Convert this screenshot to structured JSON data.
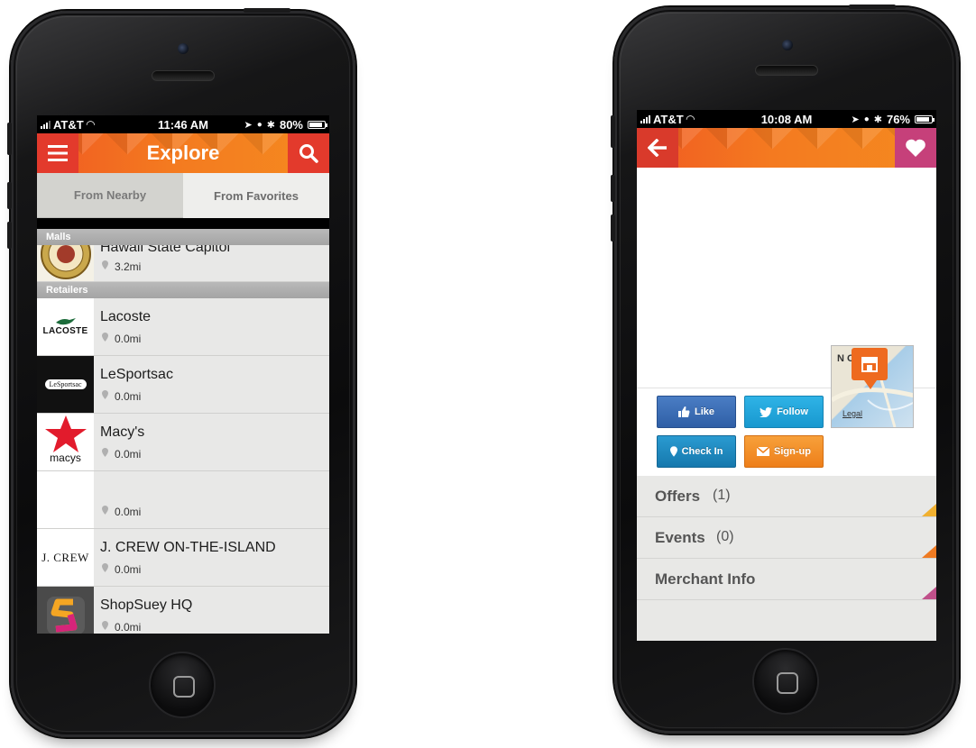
{
  "left_phone": {
    "status": {
      "carrier": "AT&T",
      "time": "11:46 AM",
      "battery": "80%"
    },
    "header": {
      "title": "Explore",
      "menu_icon": "hamburger-icon",
      "search_icon": "search-icon"
    },
    "tabs": [
      {
        "label": "From Nearby",
        "active": true
      },
      {
        "label": "From Favorites",
        "active": false
      }
    ],
    "sections": {
      "malls": {
        "title": "Malls",
        "items": [
          {
            "name": "Hawaii State Capitol",
            "distance": "3.2mi"
          }
        ]
      },
      "retailers": {
        "title": "Retailers",
        "items": [
          {
            "name": "Lacoste",
            "distance": "0.0mi",
            "logo_text": "LACOSTE"
          },
          {
            "name": "LeSportsac",
            "distance": "0.0mi",
            "logo_text": "LeSportsac"
          },
          {
            "name": "Macy's",
            "distance": "0.0mi",
            "logo_text": "macys"
          },
          {
            "name": "",
            "distance": "0.0mi",
            "logo_text": ""
          },
          {
            "name": "J. CREW ON-THE-ISLAND",
            "distance": "0.0mi",
            "logo_text": "J. CREW"
          },
          {
            "name": "ShopSuey HQ",
            "distance": "0.0mi",
            "logo_text": ""
          }
        ]
      }
    }
  },
  "right_phone": {
    "status": {
      "carrier": "AT&T",
      "time": "10:08 AM",
      "battery": "76%"
    },
    "header": {
      "back_icon": "back-arrow-icon",
      "favorite_icon": "heart-icon"
    },
    "social": {
      "like": "Like",
      "follow": "Follow",
      "checkin": "Check In",
      "signup": "Sign-up"
    },
    "map": {
      "legal": "Legal",
      "label_text": "N O  U"
    },
    "menu": [
      {
        "label": "Offers",
        "count": "(1)",
        "color": "#f0b030"
      },
      {
        "label": "Events",
        "count": "(0)",
        "color": "#ee7a22"
      },
      {
        "label": "Merchant Info",
        "count": "",
        "color": "#c0508a"
      }
    ]
  },
  "colors": {
    "brand_orange": "#f47a20",
    "header_red": "#e0402a",
    "heart_pink": "#c6407a"
  }
}
